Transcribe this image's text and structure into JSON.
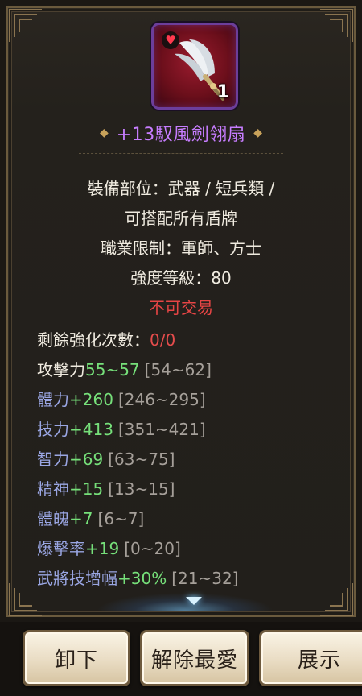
{
  "item": {
    "icon": "feather-fan-icon",
    "badge_icon": "heart-icon",
    "stack_count": "1",
    "title": "+13馭風劍翎扇"
  },
  "info_lines": [
    "裝備部位：武器 / 短兵類 /",
    "可搭配所有盾牌",
    "職業限制：軍師、方士",
    "強度等級：80",
    "不可交易"
  ],
  "enhance": {
    "label": "剩餘強化次數：",
    "value": "0/0"
  },
  "stats": [
    {
      "label": "攻擊力",
      "value": "55~57",
      "range": "[54~62]"
    },
    {
      "label": "體力",
      "value": "+260",
      "range": "[246~295]"
    },
    {
      "label": "技力",
      "value": "+413",
      "range": "[351~421]"
    },
    {
      "label": "智力",
      "value": "+69",
      "range": "[63~75]"
    },
    {
      "label": "精神",
      "value": "+15",
      "range": "[13~15]"
    },
    {
      "label": "體魄",
      "value": "+7",
      "range": "[6~7]"
    },
    {
      "label": "爆擊率",
      "value": "+19",
      "range": "[0~20]"
    },
    {
      "label": "武將技增幅",
      "value": "+30%",
      "range": "[21~32]"
    }
  ],
  "buttons": {
    "unequip": "卸下",
    "unfavorite": "解除最愛",
    "display": "展示"
  },
  "colors": {
    "title": "#c77dff",
    "value_green": "#76e07a",
    "untradeable_red": "#e74545",
    "label_blue": "#9aa6e3"
  }
}
